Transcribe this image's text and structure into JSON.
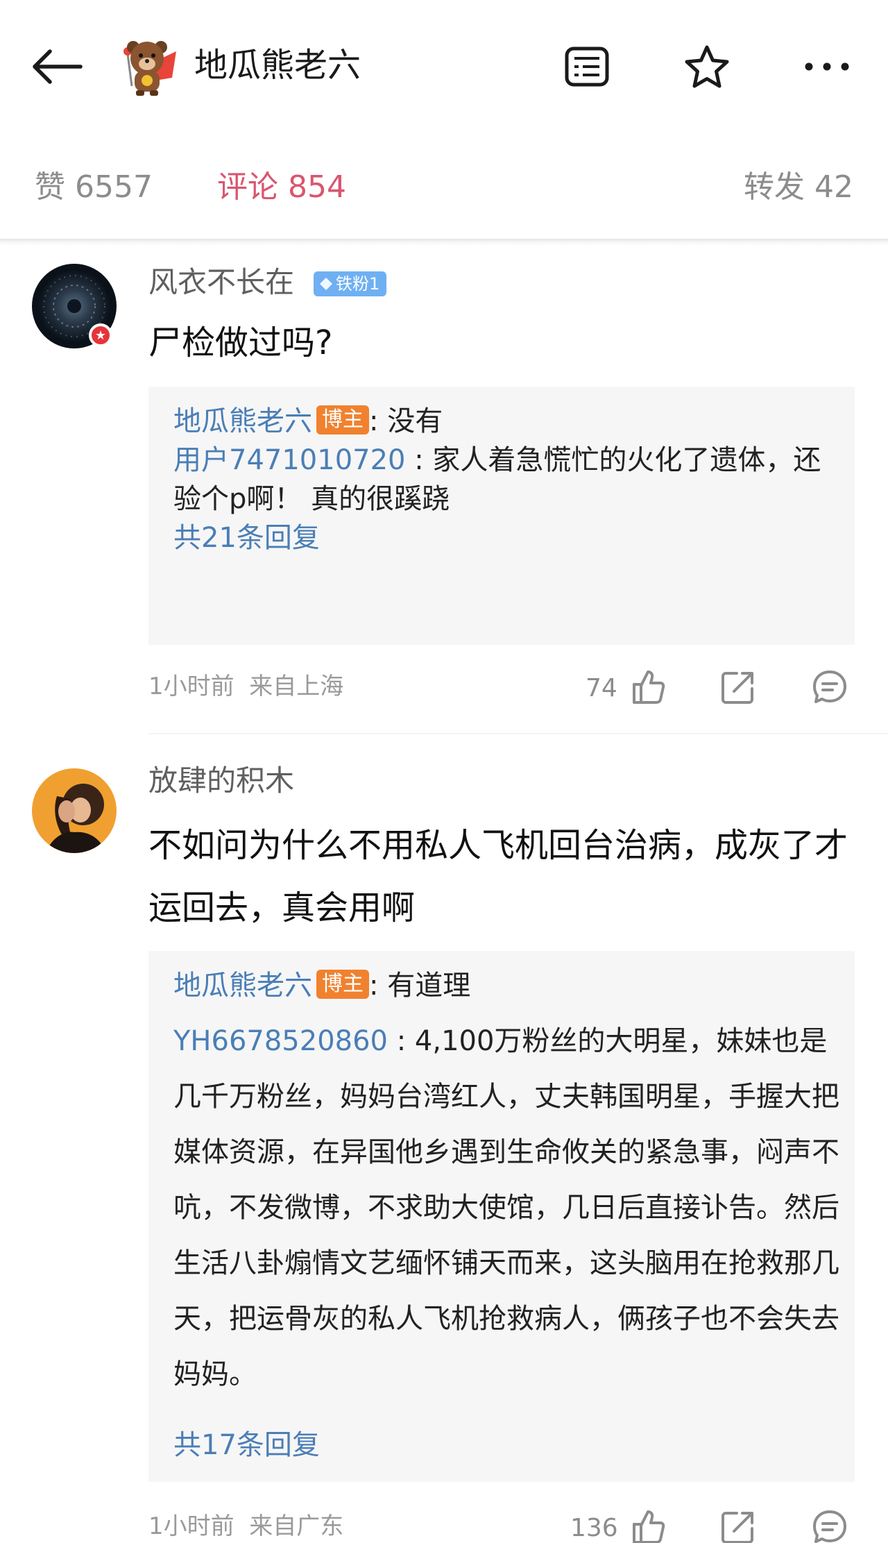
{
  "header": {
    "title": "地瓜熊老六",
    "back_icon": "back-arrow-icon",
    "icons": [
      "list-view-icon",
      "star-icon",
      "more-dots-icon"
    ]
  },
  "stats": {
    "likes": "赞 6557",
    "comments": "评论 854",
    "reposts": "转发 42"
  },
  "colors": {
    "accent": "#d9566f",
    "link": "#4a7eb6",
    "host_badge": "#f0822f",
    "fan_badge": "#6fb0f2",
    "reply_bg": "#f6f6f6"
  },
  "comments": [
    {
      "username": "风衣不长在",
      "fan_badge": "铁粉1",
      "text": "尸检做过吗?",
      "replies": [
        {
          "name": "地瓜熊老六",
          "badge": "博主",
          "text": ": 没有"
        },
        {
          "name": "用户7471010720",
          "text": " : 家人着急慌忙的火化了遗体，还验个p啊！ 真的很蹊跷"
        }
      ],
      "more_replies": "共21条回复",
      "time": "1小时前",
      "location": "来自上海",
      "like_count": "74"
    },
    {
      "username": "放肆的积木",
      "text": "不如问为什么不用私人飞机回台治病，成灰了才运回去，真会用啊",
      "replies": [
        {
          "name": "地瓜熊老六",
          "badge": "博主",
          "text": ": 有道理"
        },
        {
          "name": "YH6678520860",
          "text": " : 4,100万粉丝的大明星，妹妹也是几千万粉丝，妈妈台湾红人，丈夫韩国明星，手握大把媒体资源，在异国他乡遇到生命攸关的紧急事，闷声不吭，不发微博，不求助大使馆，几日后直接讣告。然后生活八卦煽情文艺缅怀铺天而来，这头脑用在抢救那几天，把运骨灰的私人飞机抢救病人，俩孩子也不会失去妈妈。"
        }
      ],
      "more_replies": "共17条回复",
      "time": "1小时前",
      "location": "来自广东",
      "like_count": "136"
    }
  ]
}
